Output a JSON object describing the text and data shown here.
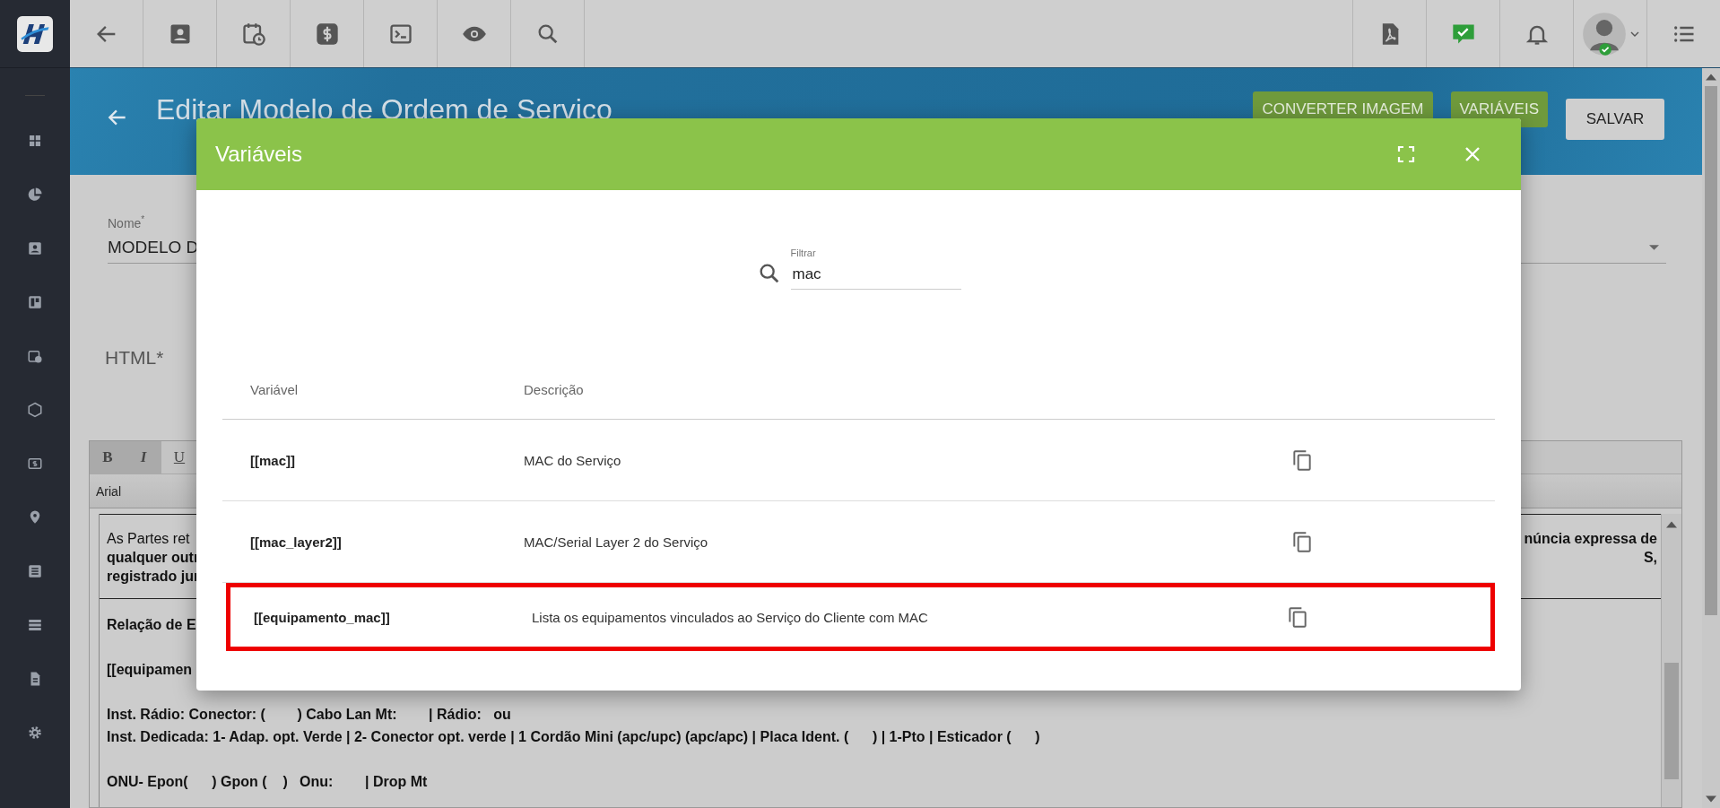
{
  "page_header": {
    "title": "Editar Modelo de Ordem de Servico",
    "buttons": [
      {
        "label": "CONVERTER IMAGEM",
        "kind": "green"
      },
      {
        "label": "VARIÁVEIS",
        "kind": "green"
      },
      {
        "label": "SALVAR",
        "kind": "plain"
      }
    ]
  },
  "form": {
    "name_field": {
      "label": "Nome",
      "required_mark": "*",
      "value": "MODELO D"
    },
    "html_label": "HTML*"
  },
  "editor": {
    "toolbar": [
      "B",
      "I",
      "U"
    ],
    "font": "Arial",
    "lines": [
      {
        "left": "As Partes ret",
        "right": "núncia expressa de",
        "bold": false,
        "right_bold": true
      },
      {
        "left": "qualquer outr",
        "right": "S,",
        "bold": true,
        "right_bold": true
      },
      {
        "left": "registrado jur",
        "bold": true
      }
    ],
    "body_paragraphs": [
      [
        "Relação de E"
      ],
      [
        "[[equipamen"
      ],
      [
        "Inst. Rádio: Conector: (        ) Cabo Lan Mt:        | Rádio:   ou",
        "Inst. Dedicada: 1- Adap. opt. Verde | 2- Conector opt. verde | 1 Cordão Mini (apc/upc) (apc/apc) | Placa Ident. (      ) | 1-Pto | Esticador (      )"
      ],
      [
        "ONU- Epon(      ) Gpon (    )   Onu:        | Drop Mt"
      ]
    ]
  },
  "dialog": {
    "title": "Variáveis",
    "filter": {
      "label": "Filtrar",
      "value": "mac"
    },
    "columns": [
      "Variável",
      "Descrição"
    ],
    "rows": [
      {
        "variable": "[[mac]]",
        "description": "MAC do Serviço",
        "highlighted": false
      },
      {
        "variable": "[[mac_layer2]]",
        "description": "MAC/Serial Layer 2 do Serviço",
        "highlighted": false
      },
      {
        "variable": "[[equipamento_mac]]",
        "description": "Lista os equipamentos vinculados ao Serviço do Cliente com MAC",
        "highlighted": true
      }
    ]
  }
}
